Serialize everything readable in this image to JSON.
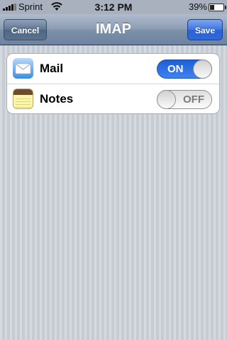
{
  "status_bar": {
    "carrier": "Sprint",
    "time": "3:12 PM",
    "battery_percent": "39%",
    "battery_level": 0.39,
    "icons": [
      "signal-icon",
      "wifi-icon",
      "battery-icon"
    ]
  },
  "nav": {
    "title": "IMAP",
    "cancel_label": "Cancel",
    "save_label": "Save"
  },
  "settings": {
    "items": [
      {
        "label": "Mail",
        "icon": "mail-icon",
        "toggle": "ON",
        "enabled": true
      },
      {
        "label": "Notes",
        "icon": "notes-icon",
        "toggle": "OFF",
        "enabled": false
      }
    ]
  },
  "colors": {
    "toggle_on": "#2f72e8",
    "save_button": "#2f69da",
    "nav_bar": "#7e91a9",
    "background": "#c5ccd4"
  }
}
